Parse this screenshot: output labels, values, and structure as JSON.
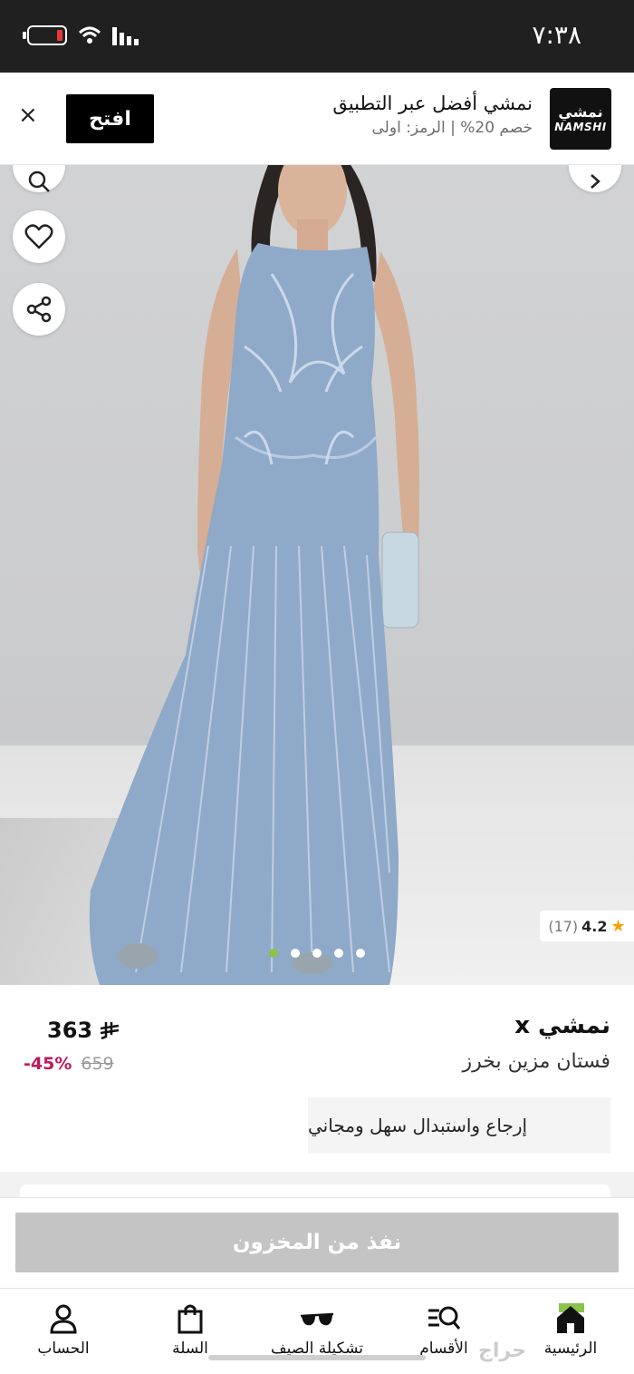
{
  "status_bar": {
    "time": "٧:٣٨",
    "icons": [
      "battery-icon",
      "wifi-icon",
      "signal-icon"
    ]
  },
  "app_banner": {
    "close_label": "×",
    "open_label": "افتح",
    "logo_arabic": "نمشي",
    "logo_english": "NAMSHI",
    "title": "نمشي أفضل عبر التطبيق",
    "subtitle": "خصم 20% | الرمز: اولى"
  },
  "product": {
    "rating": "4.2",
    "rating_count": "(17)",
    "image_count": 5,
    "active_image": 0,
    "brand": "نمشي x",
    "title": "فستان مزين بخرز",
    "price": "363",
    "old_price": "659",
    "discount": "-45%",
    "returns_text": "إرجاع واستبدال سهل ومجاني"
  },
  "actions": {
    "out_of_stock_label": "نفذ من المخزون"
  },
  "bottom_nav": {
    "items": [
      {
        "label": "الحساب",
        "icon": "account-icon"
      },
      {
        "label": "السلة",
        "icon": "bag-icon"
      },
      {
        "label": "تشكيلة الصيف",
        "icon": "sunglasses-icon"
      },
      {
        "label": "الأقسام",
        "icon": "categories-search-icon"
      },
      {
        "label": "الرئيسية",
        "icon": "home-icon"
      }
    ]
  },
  "watermark": "حراج",
  "colors": {
    "accent_green": "#8bc34a",
    "discount": "#c2185b",
    "status_bar": "#202020",
    "out_of_stock": "#c4c4c4",
    "dress": "#8fa9c9"
  }
}
